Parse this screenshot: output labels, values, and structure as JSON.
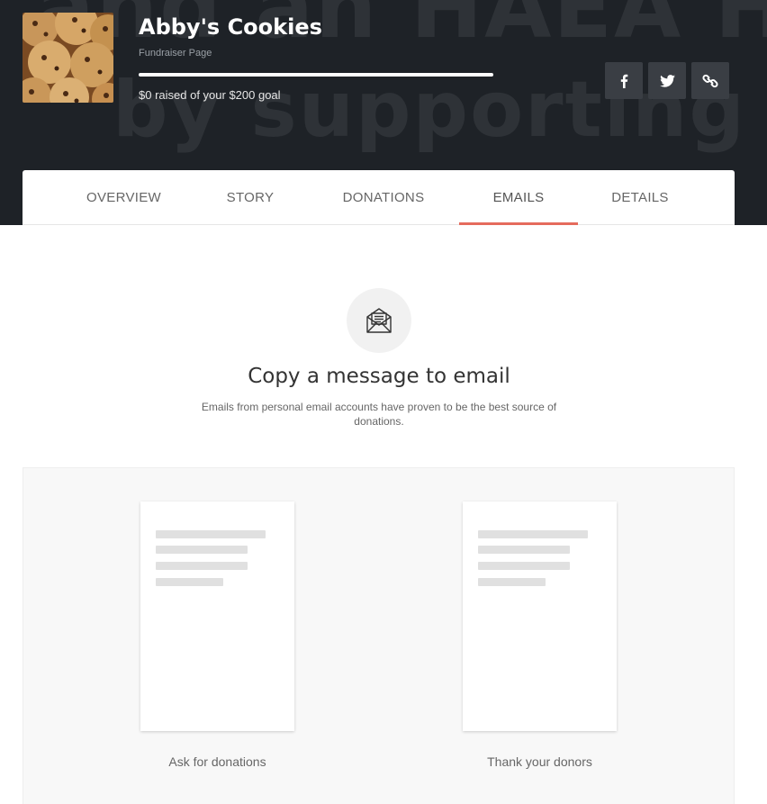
{
  "header": {
    "title": "Abby's Cookies",
    "subtitle": "Fundraiser Page",
    "raised_text": "$0 raised of your $200 goal",
    "progress_fraction": 0,
    "background_text_1": "and an HAEA HE",
    "background_text_2": "by supporting me!",
    "share": {
      "facebook_icon": "facebook-icon",
      "twitter_icon": "twitter-icon",
      "link_icon": "link-icon"
    }
  },
  "tabs": [
    {
      "label": "OVERVIEW",
      "active": false
    },
    {
      "label": "STORY",
      "active": false
    },
    {
      "label": "DONATIONS",
      "active": false
    },
    {
      "label": "EMAILS",
      "active": true
    },
    {
      "label": "DETAILS",
      "active": false
    }
  ],
  "emails": {
    "icon": "envelope-open-icon",
    "title": "Copy a message to email",
    "description": "Emails from personal email accounts have proven to be the best source of donations.",
    "templates": [
      {
        "label": "Ask for donations"
      },
      {
        "label": "Thank your donors"
      }
    ]
  },
  "colors": {
    "header_bg": "#1e2227",
    "accent": "#e56b5d",
    "share_button_bg": "#3a3e44"
  }
}
